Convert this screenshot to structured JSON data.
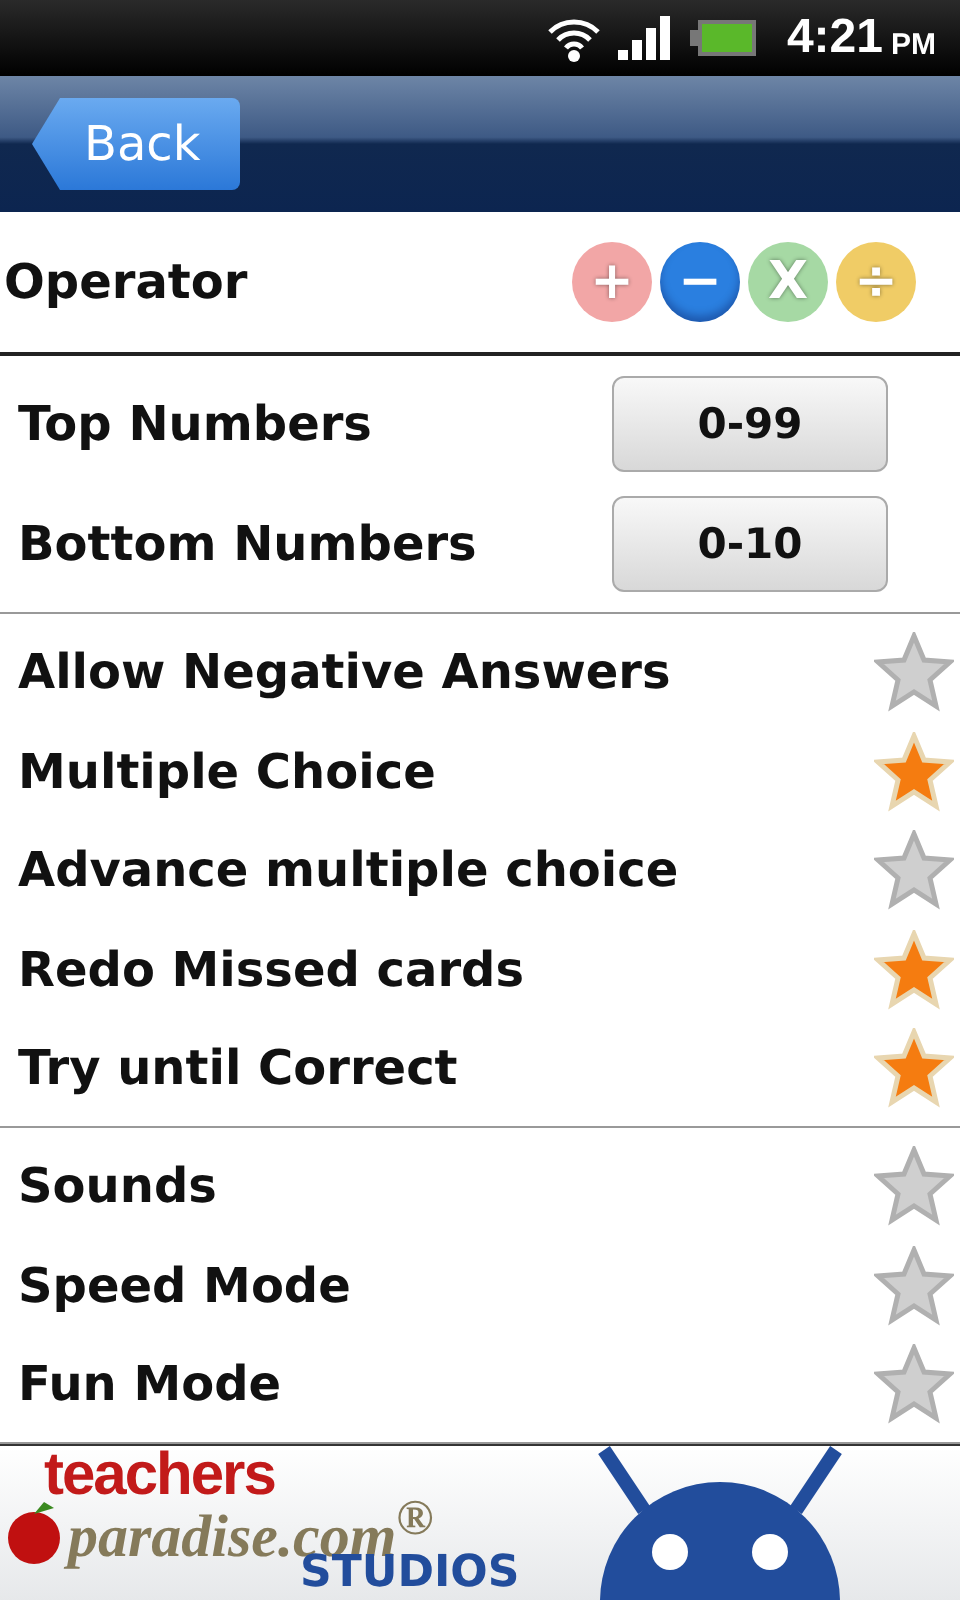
{
  "status_bar": {
    "time": "4:21",
    "ampm": "PM"
  },
  "header": {
    "back": "Back"
  },
  "operator": {
    "label": "Operator",
    "options": [
      {
        "symbol": "+",
        "color": "#f2a6a6",
        "selected": false
      },
      {
        "symbol": "−",
        "color": "#2a7fe0",
        "selected": true
      },
      {
        "symbol": "X",
        "color": "#a6d9a4",
        "selected": false
      },
      {
        "symbol": "÷",
        "color": "#f0cc66",
        "selected": false
      }
    ]
  },
  "ranges": [
    {
      "label": "Top Numbers",
      "value": "0-99"
    },
    {
      "label": "Bottom Numbers",
      "value": "0-10"
    }
  ],
  "option_groups": [
    [
      {
        "label": "Allow Negative Answers",
        "on": false
      },
      {
        "label": "Multiple Choice",
        "on": true
      },
      {
        "label": "Advance multiple choice",
        "on": false
      },
      {
        "label": "Redo Missed cards",
        "on": true
      },
      {
        "label": "Try until Correct",
        "on": true
      }
    ],
    [
      {
        "label": "Sounds",
        "on": false
      },
      {
        "label": "Speed Mode",
        "on": false
      },
      {
        "label": "Fun Mode",
        "on": false
      }
    ]
  ],
  "ad": {
    "line_1": "teachers",
    "line_2": "paradise.com$^{®}$",
    "line_3": "STUDIOS"
  }
}
